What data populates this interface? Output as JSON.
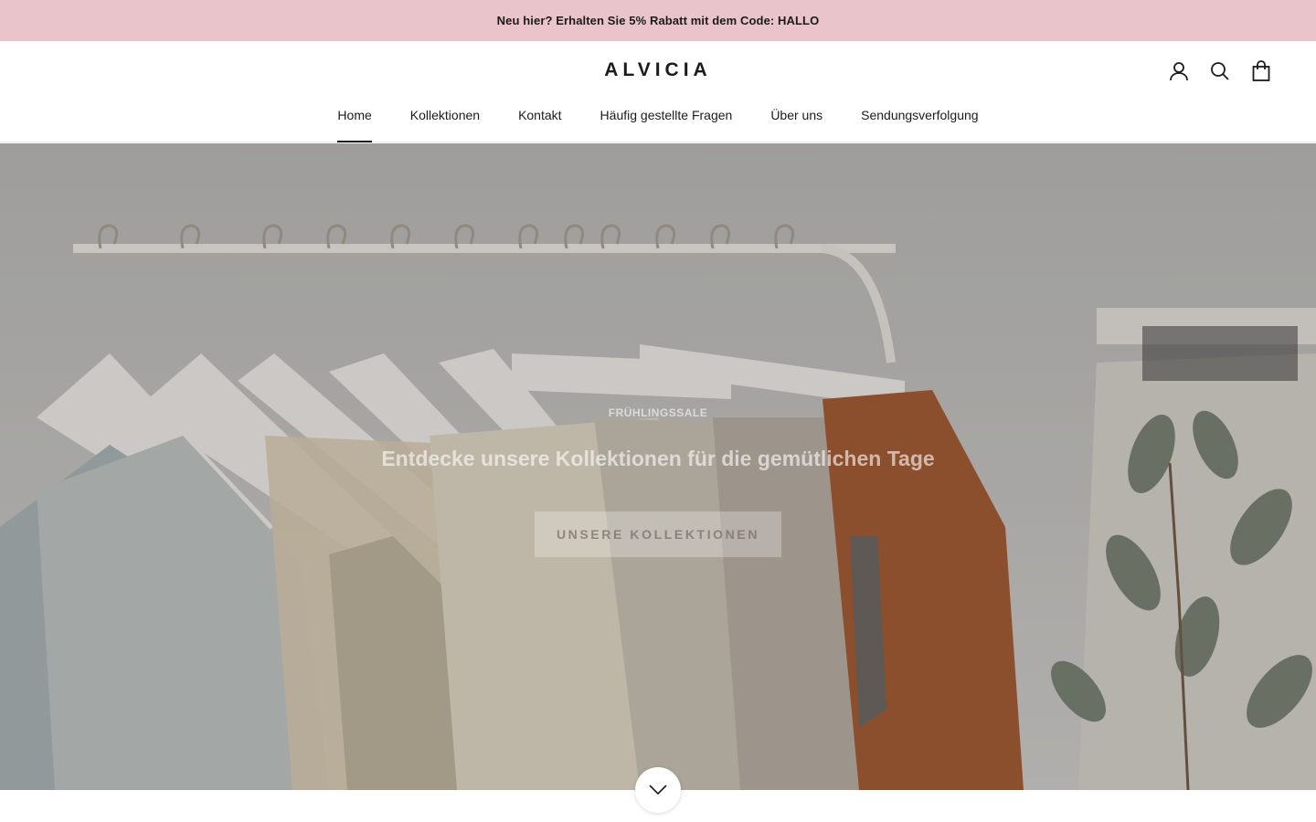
{
  "announcement": {
    "text": "Neu hier? Erhalten Sie 5% Rabatt mit dem Code: HALLO"
  },
  "brand": {
    "logo": "ALVICIA"
  },
  "header_icons": [
    "account-icon",
    "search-icon",
    "cart-bag-icon"
  ],
  "nav": {
    "items": [
      {
        "label": "Home",
        "active": true
      },
      {
        "label": "Kollektionen"
      },
      {
        "label": "Kontakt"
      },
      {
        "label": "Häufig gestellte Fragen"
      },
      {
        "label": "Über uns"
      },
      {
        "label": "Sendungsverfolgung"
      }
    ]
  },
  "hero": {
    "subheading": "FRÜHLINGSSALE",
    "title": "Entdecke unsere Kollektionen für die gemütlichen Tage",
    "button_label": "UNSERE KOLLEKTIONEN"
  },
  "scroll_icon": "chevron-down-icon",
  "colors": {
    "announcement_bg": "#e9c4ca",
    "text": "#1c1b1b"
  }
}
